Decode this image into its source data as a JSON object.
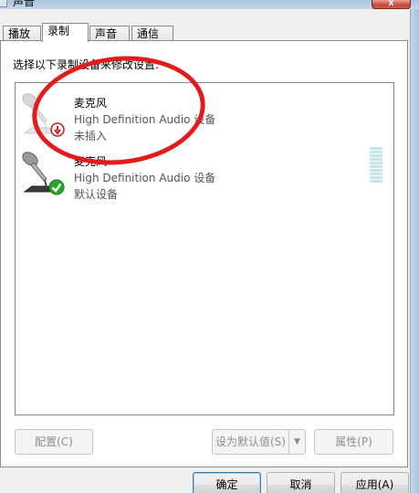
{
  "window": {
    "title": "声音",
    "close_label": "X"
  },
  "tabs": [
    {
      "label": "播放",
      "active": false
    },
    {
      "label": "录制",
      "active": true
    },
    {
      "label": "声音",
      "active": false
    },
    {
      "label": "通信",
      "active": false
    }
  ],
  "instruction": "选择以下录制设备来修改设置:",
  "devices": [
    {
      "name": "麦克风",
      "description": "High Definition Audio 设备",
      "status": "未插入",
      "state": "not-plugged-in"
    },
    {
      "name": "麦克风",
      "description": "High Definition Audio 设备",
      "status": "默认设备",
      "state": "default"
    }
  ],
  "buttons": {
    "configure": "配置(C)",
    "set_default": "设为默认值(S)",
    "properties": "属性(P)",
    "ok": "确定",
    "cancel": "取消",
    "apply": "应用(A)"
  },
  "colors": {
    "annotation_red": "#e51b1b",
    "default_check_green": "#2aa52a",
    "unplugged_red": "#c81e1e",
    "level_meter": "#c9e6ec"
  }
}
